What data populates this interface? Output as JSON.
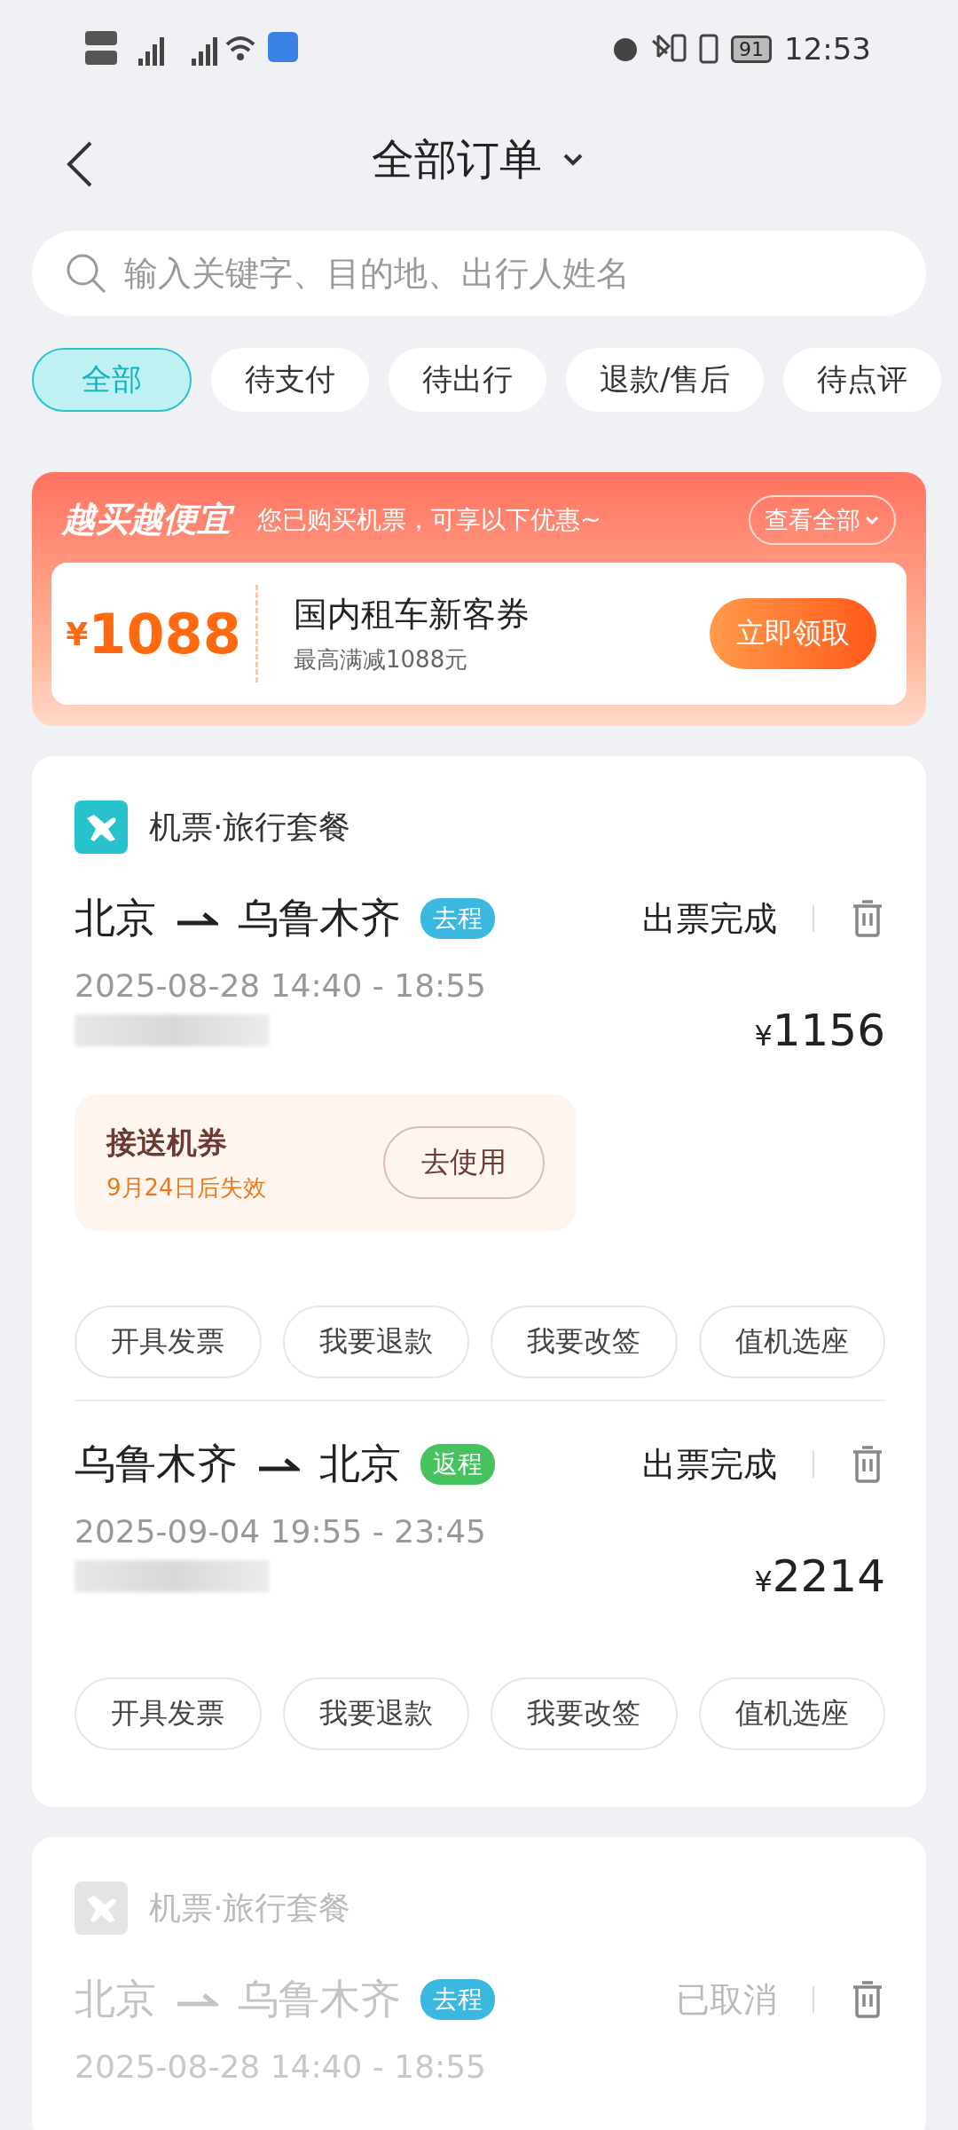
{
  "status_bar": {
    "time": "12:53",
    "battery": "91"
  },
  "header": {
    "title": "全部订单"
  },
  "search": {
    "placeholder": "输入关键字、目的地、出行人姓名"
  },
  "tabs": [
    {
      "label": "全部",
      "selected": true
    },
    {
      "label": "待支付",
      "selected": false
    },
    {
      "label": "待出行",
      "selected": false
    },
    {
      "label": "退款/售后",
      "selected": false
    },
    {
      "label": "待点评",
      "selected": false
    }
  ],
  "promo": {
    "title": "越买越便宜",
    "subtitle": "您已购买机票，可享以下优惠~",
    "view_all": "查看全部",
    "coupon": {
      "currency": "¥",
      "amount": "1088",
      "name": "国内租车新客券",
      "desc": "最高满减1088元",
      "button": "立即领取"
    }
  },
  "orders": [
    {
      "category": "机票·旅行套餐",
      "disabled": false,
      "legs": [
        {
          "from": "北京",
          "to": "乌鲁木齐",
          "tag": "去程",
          "color": "#3bb8e0",
          "status": "出票完成",
          "time": "2025-08-28 14:40 - 18:55",
          "price": "1156",
          "currency": "¥",
          "coupon": {
            "title": "接送机券",
            "expiry": "9月24日后失效",
            "button": "去使用"
          },
          "actions": [
            "开具发票",
            "我要退款",
            "我要改签",
            "值机选座"
          ]
        },
        {
          "from": "乌鲁木齐",
          "to": "北京",
          "tag": "返程",
          "color": "#46c25e",
          "status": "出票完成",
          "time": "2025-09-04 19:55 - 23:45",
          "price": "2214",
          "currency": "¥",
          "actions": [
            "开具发票",
            "我要退款",
            "我要改签",
            "值机选座"
          ]
        }
      ]
    },
    {
      "category": "机票·旅行套餐",
      "disabled": true,
      "legs": [
        {
          "from": "北京",
          "to": "乌鲁木齐",
          "tag": "去程",
          "color": "#3bb8e0",
          "status": "已取消",
          "time": "2025-08-28 14:40 - 18:55"
        }
      ]
    }
  ]
}
